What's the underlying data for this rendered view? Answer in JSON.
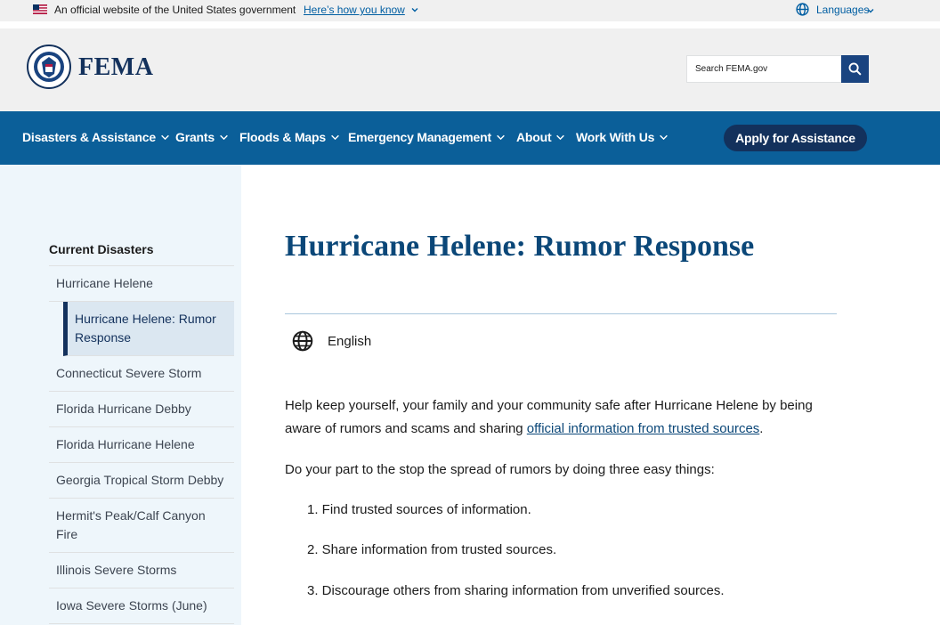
{
  "gov_banner": {
    "official_text": "An official website of the United States government",
    "how_know_link": "Here’s how you know",
    "languages_label": "Languages"
  },
  "header": {
    "logo_text": "FEMA",
    "search_placeholder": "Search FEMA.gov"
  },
  "nav": {
    "items": [
      {
        "label": "Disasters & Assistance"
      },
      {
        "label": "Grants"
      },
      {
        "label": "Floods & Maps"
      },
      {
        "label": "Emergency Management"
      },
      {
        "label": "About"
      },
      {
        "label": "Work With Us"
      }
    ],
    "apply_button": "Apply for Assistance"
  },
  "sidebar": {
    "title": "Current Disasters",
    "items": [
      {
        "label": "Hurricane Helene"
      },
      {
        "label": "Hurricane Helene: Rumor Response"
      },
      {
        "label": "Connecticut Severe Storm"
      },
      {
        "label": "Florida Hurricane Debby"
      },
      {
        "label": "Florida Hurricane Helene"
      },
      {
        "label": "Georgia Tropical Storm Debby"
      },
      {
        "label": "Hermit's Peak/Calf Canyon Fire"
      },
      {
        "label": "Illinois Severe Storms"
      },
      {
        "label": "Iowa Severe Storms (June)"
      }
    ]
  },
  "main": {
    "title": "Hurricane Helene: Rumor Response",
    "language": "English",
    "intro_text": "Help keep yourself, your family and your community safe after Hurricane Helene by being aware of rumors and scams and sharing ",
    "intro_link": "official information from trusted sources",
    "intro_end": ".",
    "subhead": "Do your part to the stop the spread of rumors by doing three easy things:",
    "steps": [
      "1. Find trusted sources of information.",
      "2. Share information from trusted sources.",
      "3. Discourage others from sharing information from unverified sources."
    ]
  },
  "colors": {
    "nav_bg": "#0b5f99",
    "brand_navy": "#13315c",
    "title_blue": "#0b4778",
    "sidebar_bg": "#eef6fb"
  }
}
